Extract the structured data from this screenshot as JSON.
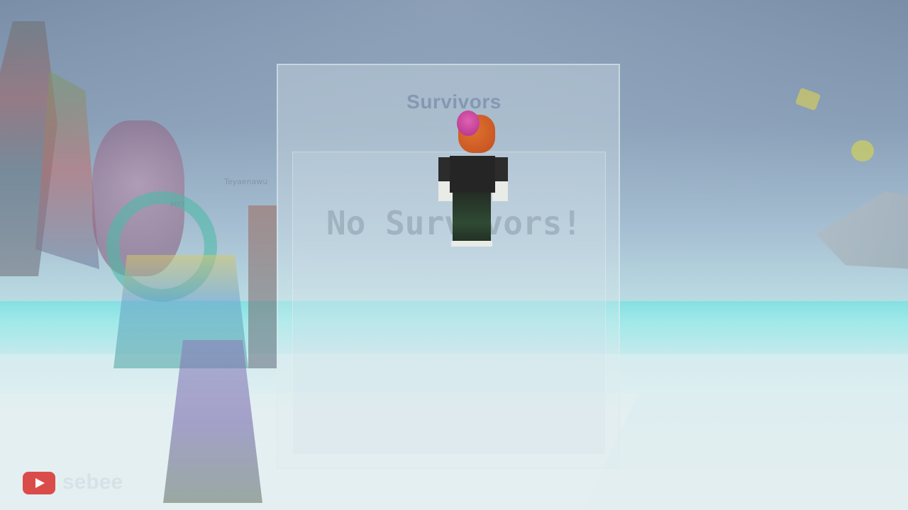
{
  "survivors_panel": {
    "title": "Survivors",
    "empty_message": "No Survivors!"
  },
  "players": {
    "nametag_1": "Teyaenawu",
    "nametag_2": "MYT"
  },
  "watermark": {
    "icon": "youtube-icon",
    "channel": "sebee"
  },
  "colors": {
    "sky": "#8aa0b8",
    "water_band": "#7fe0e2",
    "youtube_red": "#d9302e"
  }
}
